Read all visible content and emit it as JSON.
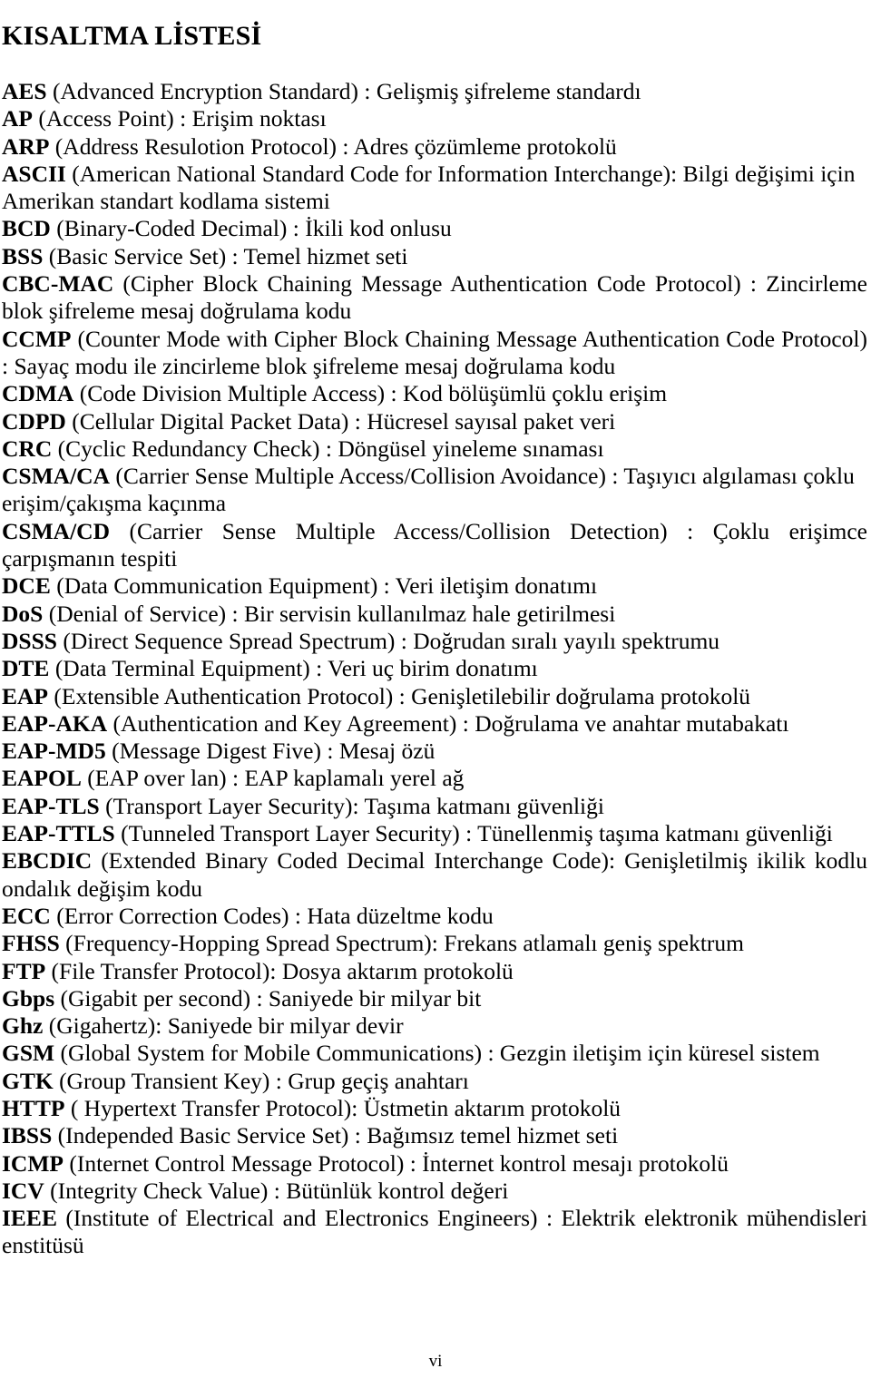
{
  "document": {
    "title": "KISALTMA LİSTESİ",
    "page_number": "vi"
  },
  "entries": [
    {
      "abbr": "AES",
      "rest": " (Advanced Encryption Standard) : Gelişmiş şifreleme standardı",
      "justify": false
    },
    {
      "abbr": "AP",
      "rest": " (Access Point) : Erişim noktası",
      "justify": false
    },
    {
      "abbr": "ARP",
      "rest": " (Address Resulotion Protocol) : Adres çözümleme protokolü",
      "justify": false
    },
    {
      "abbr": "ASCII",
      "rest": " (American National Standard Code for Information Interchange): Bilgi değişimi için Amerikan standart kodlama sistemi",
      "justify": false
    },
    {
      "abbr": "BCD",
      "rest": " (Binary-Coded Decimal) : İkili kod onlusu",
      "justify": false
    },
    {
      "abbr": "BSS",
      "rest": " (Basic Service Set) : Temel hizmet seti",
      "justify": false
    },
    {
      "abbr": "CBC-MAC",
      "rest": " (Cipher Block Chaining Message Authentication Code Protocol) : Zincirleme blok şifreleme mesaj doğrulama kodu",
      "justify": true
    },
    {
      "abbr": "CCMP",
      "rest": " (Counter Mode with Cipher Block Chaining Message Authentication Code Protocol) : Sayaç modu ile zincirleme blok şifreleme mesaj doğrulama kodu",
      "justify": true
    },
    {
      "abbr": "CDMA",
      "rest": " (Code Division Multiple Access) : Kod bölüşümlü çoklu erişim",
      "justify": false
    },
    {
      "abbr": "CDPD",
      "rest": " (Cellular Digital Packet Data) : Hücresel sayısal paket veri",
      "justify": false
    },
    {
      "abbr": "CRC",
      "rest": " (Cyclic Redundancy Check) : Döngüsel yineleme sınaması",
      "justify": false
    },
    {
      "abbr": "CSMA/CA",
      "rest": " (Carrier Sense Multiple Access/Collision Avoidance) : Taşıyıcı algılaması çoklu erişim/çakışma kaçınma",
      "justify": false
    },
    {
      "abbr": "CSMA/CD",
      "rest": " (Carrier Sense Multiple Access/Collision Detection) : Çoklu erişimce çarpışmanın tespiti",
      "justify": true
    },
    {
      "abbr": "DCE",
      "rest": " (Data Communication Equipment) : Veri iletişim donatımı",
      "justify": false
    },
    {
      "abbr": "DoS",
      "rest": " (Denial of Service) : Bir servisin kullanılmaz hale getirilmesi",
      "justify": false
    },
    {
      "abbr": "DSSS",
      "rest": " (Direct Sequence Spread Spectrum) : Doğrudan sıralı yayılı spektrumu",
      "justify": false
    },
    {
      "abbr": "DTE",
      "rest": " (Data Terminal Equipment) : Veri uç birim donatımı",
      "justify": false
    },
    {
      "abbr": "EAP",
      "rest": " (Extensible Authentication Protocol) : Genişletilebilir doğrulama protokolü",
      "justify": false
    },
    {
      "abbr": "EAP-AKA",
      "rest": " (Authentication and Key Agreement) : Doğrulama ve anahtar mutabakatı",
      "justify": false
    },
    {
      "abbr": "EAP-MD5",
      "rest": " (Message Digest Five)  : Mesaj özü",
      "justify": false
    },
    {
      "abbr": "EAPOL",
      "rest": " (EAP over lan) : EAP kaplamalı yerel ağ",
      "justify": false
    },
    {
      "abbr": "EAP-TLS",
      "rest": " (Transport Layer Security): Taşıma katmanı güvenliği",
      "justify": false
    },
    {
      "abbr": "EAP-TTLS",
      "rest": " (Tunneled Transport Layer Security) : Tünellenmiş taşıma katmanı güvenliği",
      "justify": true
    },
    {
      "abbr": "EBCDIC",
      "rest": " (Extended Binary Coded Decimal Interchange Code): Genişletilmiş ikilik kodlu ondalık değişim kodu",
      "justify": true
    },
    {
      "abbr": "ECC",
      "rest": " (Error Correction Codes) : Hata düzeltme kodu",
      "justify": false
    },
    {
      "abbr": "FHSS",
      "rest": " (Frequency-Hopping Spread Spectrum): Frekans atlamalı geniş spektrum",
      "justify": false
    },
    {
      "abbr": "FTP",
      "rest": " (File Transfer Protocol): Dosya aktarım protokolü",
      "justify": false
    },
    {
      "abbr": "Gbps",
      "rest": " (Gigabit per second) : Saniyede bir milyar bit",
      "justify": false
    },
    {
      "abbr": "Ghz",
      "rest": " (Gigahertz): Saniyede bir milyar devir",
      "justify": false
    },
    {
      "abbr": "GSM",
      "rest": " (Global System for Mobile Communications) : Gezgin iletişim için küresel sistem",
      "justify": false
    },
    {
      "abbr": "GTK",
      "rest": " (Group Transient Key) : Grup geçiş anahtarı",
      "justify": false
    },
    {
      "abbr": "HTTP",
      "rest": " ( Hypertext Transfer Protocol): Üstmetin aktarım protokolü",
      "justify": false
    },
    {
      "abbr": "IBSS",
      "rest": " (Independed Basic Service Set) : Bağımsız temel hizmet seti",
      "justify": false
    },
    {
      "abbr": "ICMP",
      "rest": " (Internet Control Message Protocol) : İnternet kontrol mesajı protokolü",
      "justify": false
    },
    {
      "abbr": "ICV",
      "rest": " (Integrity Check Value) : Bütünlük kontrol değeri",
      "justify": false
    },
    {
      "abbr": "IEEE",
      "rest": " (Institute of Electrical and Electronics Engineers) : Elektrik elektronik mühendisleri enstitüsü",
      "justify": true
    }
  ]
}
